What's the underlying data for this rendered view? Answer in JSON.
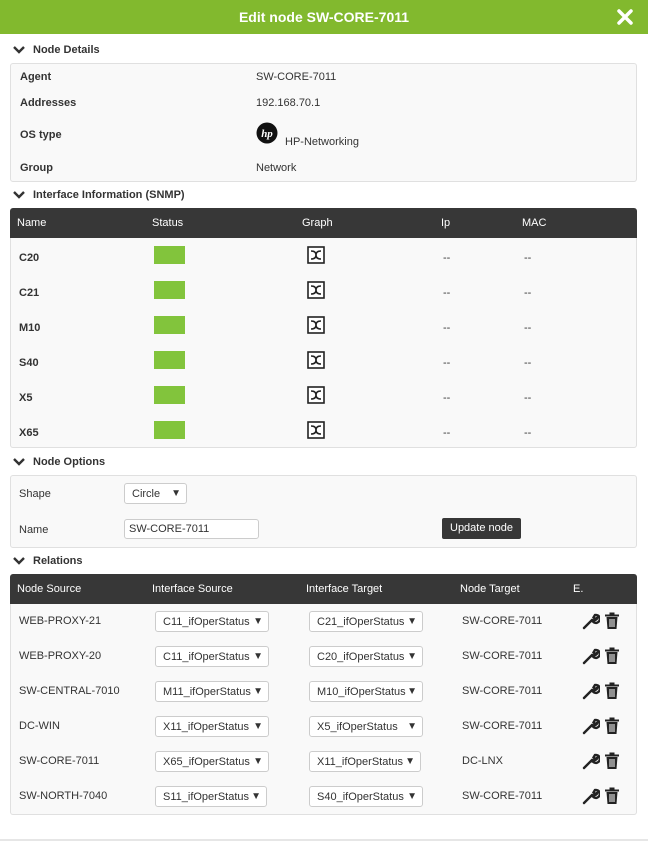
{
  "window": {
    "title": "Edit node SW-CORE-7011",
    "close_icon": "close-icon"
  },
  "node_details": {
    "heading": "Node Details",
    "agent_label": "Agent",
    "agent_value": "SW-CORE-7011",
    "addresses_label": "Addresses",
    "addresses_value": "192.168.70.1",
    "os_label": "OS type",
    "os_value": "HP-Networking",
    "os_icon": "hp-logo-icon",
    "group_label": "Group",
    "group_value": "Network"
  },
  "interfaces": {
    "heading": "Interface Information (SNMP)",
    "columns": [
      "Name",
      "Status",
      "Graph",
      "Ip",
      "MAC"
    ],
    "status_color": "#82c43c",
    "rows": [
      {
        "name": "C20",
        "ip": "--",
        "mac": "--"
      },
      {
        "name": "C21",
        "ip": "--",
        "mac": "--"
      },
      {
        "name": "M10",
        "ip": "--",
        "mac": "--"
      },
      {
        "name": "S40",
        "ip": "--",
        "mac": "--"
      },
      {
        "name": "X5",
        "ip": "--",
        "mac": "--"
      },
      {
        "name": "X65",
        "ip": "--",
        "mac": "--"
      }
    ]
  },
  "node_options": {
    "heading": "Node Options",
    "shape_label": "Shape",
    "shape_value": "Circle",
    "name_label": "Name",
    "name_value": "SW-CORE-7011",
    "update_button": "Update node"
  },
  "relations": {
    "heading": "Relations",
    "columns": [
      "Node Source",
      "Interface Source",
      "Interface Target",
      "Node Target",
      "E."
    ],
    "rows": [
      {
        "source": "WEB-PROXY-21",
        "if_source": "C11_ifOperStatus",
        "if_target": "C21_ifOperStatus",
        "target": "SW-CORE-7011"
      },
      {
        "source": "WEB-PROXY-20",
        "if_source": "C11_ifOperStatus",
        "if_target": "C20_ifOperStatus",
        "target": "SW-CORE-7011"
      },
      {
        "source": "SW-CENTRAL-7010",
        "if_source": "M11_ifOperStatus",
        "if_target": "M10_ifOperStatus",
        "target": "SW-CORE-7011"
      },
      {
        "source": "DC-WIN",
        "if_source": "X11_ifOperStatus",
        "if_target": "X5_ifOperStatus",
        "target": "SW-CORE-7011"
      },
      {
        "source": "SW-CORE-7011",
        "if_source": "X65_ifOperStatus",
        "if_target": "X11_ifOperStatus",
        "target": "DC-LNX"
      },
      {
        "source": "SW-NORTH-7040",
        "if_source": "S11_ifOperStatus",
        "if_target": "S40_ifOperStatus",
        "target": "SW-CORE-7011"
      }
    ]
  },
  "colors": {
    "brand_green": "#82b92e",
    "header_dark": "#373737"
  }
}
